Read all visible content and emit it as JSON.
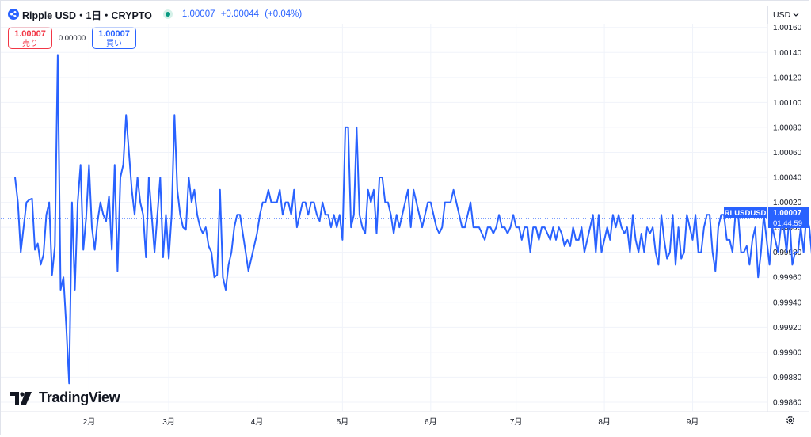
{
  "header": {
    "symbol_title": "Ripple USD・1日・CRYPTO",
    "price": "1.00007",
    "change": "+0.00044",
    "change_pct": "(+0.04%)"
  },
  "trade": {
    "sell_price": "1.00007",
    "sell_label": "売り",
    "spread": "0.00000",
    "buy_price": "1.00007",
    "buy_label": "買い"
  },
  "currency_selector": "USD",
  "brand": "TradingView",
  "last_price_label": {
    "symbol": "RLUSDUSD",
    "price": "1.00007",
    "countdown": "01:44:59"
  },
  "colors": {
    "line": "#2962ff",
    "grid": "#f0f3fa",
    "axis_text": "#131722",
    "label_bg": "#2962ff"
  },
  "icons": [
    "ripple-logo-icon",
    "live-dot-icon",
    "chevron-down-icon",
    "tradingview-logo-icon",
    "gear-icon"
  ],
  "chart_data": {
    "type": "line",
    "title": "Ripple USD・1日・CRYPTO",
    "xlabel": "",
    "ylabel": "",
    "x_range": [
      "2025-01-01",
      "2025-09-27"
    ],
    "ylim": [
      0.99853,
      1.00163
    ],
    "y_ticks": [
      1.0016,
      1.0014,
      1.0012,
      1.001,
      1.0008,
      1.0006,
      1.0004,
      1.0002,
      1.0,
      0.9998,
      0.9996,
      0.9994,
      0.9992,
      0.999,
      0.9988,
      0.9986
    ],
    "y_tick_labels": [
      "1.00160",
      "1.00140",
      "1.00120",
      "1.00100",
      "1.00080",
      "1.00060",
      "1.00040",
      "1.00020",
      "1.00000",
      "0.99980",
      "0.99960",
      "0.99940",
      "0.99920",
      "0.99900",
      "0.99880",
      "0.99860"
    ],
    "x_ticks": [
      {
        "date": "2025-02-01",
        "label": "2月"
      },
      {
        "date": "2025-03-01",
        "label": "3月"
      },
      {
        "date": "2025-04-01",
        "label": "4月"
      },
      {
        "date": "2025-05-01",
        "label": "5月"
      },
      {
        "date": "2025-06-01",
        "label": "6月"
      },
      {
        "date": "2025-07-01",
        "label": "7月"
      },
      {
        "date": "2025-08-01",
        "label": "8月"
      },
      {
        "date": "2025-09-01",
        "label": "9月"
      }
    ],
    "grid": true,
    "series": [
      {
        "x_start": "2025-01-06",
        "interval_days": 1,
        "values": [
          1.0004,
          1.0002,
          0.9998,
          1.0,
          1.0002,
          1.00022,
          1.00023,
          0.99982,
          0.99987,
          0.9997,
          0.99978,
          1.0001,
          1.0002,
          0.99962,
          0.99985,
          1.00138,
          0.9995,
          0.9996,
          0.9992,
          0.99875,
          1.0002,
          0.9995,
          1.0002,
          1.0005,
          0.99982,
          1.00008,
          1.0005,
          1.0,
          0.99982,
          1.00005,
          1.0002,
          1.0001,
          1.00005,
          1.00025,
          0.99982,
          1.0005,
          0.99965,
          1.0004,
          1.0005,
          1.0009,
          1.0006,
          1.0003,
          1.0001,
          1.0004,
          1.0002,
          1.0001,
          0.99976,
          1.0004,
          1.0001,
          0.9998,
          1.0001,
          1.0004,
          0.99976,
          1.0001,
          0.99975,
          1.0001,
          1.0009,
          1.0003,
          1.0001,
          1.0,
          0.99998,
          1.0004,
          1.0002,
          1.0003,
          1.0001,
          1.0,
          0.99995,
          1.0,
          0.99985,
          0.9998,
          0.9996,
          0.99962,
          1.0003,
          0.9996,
          0.9995,
          0.9997,
          0.9998,
          1.0,
          1.0001,
          1.0001,
          0.99995,
          0.9998,
          0.99965,
          0.99975,
          0.99985,
          0.99995,
          1.0001,
          1.0002,
          1.0002,
          1.0003,
          1.0002,
          1.0002,
          1.0002,
          1.0003,
          1.0001,
          1.0002,
          1.0002,
          1.0001,
          1.0003,
          1.0,
          1.0001,
          1.0002,
          1.0002,
          1.0001,
          1.0002,
          1.0002,
          1.0001,
          1.00005,
          1.0002,
          1.0001,
          1.0001,
          1.0,
          1.0001,
          1.0,
          1.0001,
          0.9999,
          1.0008,
          1.0008,
          1.0,
          1.0001,
          1.0008,
          1.0001,
          1.0,
          0.99995,
          1.0003,
          1.0002,
          1.0003,
          0.99995,
          1.0004,
          1.0004,
          1.0002,
          1.0002,
          1.0001,
          0.99995,
          1.0001,
          1.0,
          1.0001,
          1.0002,
          1.0003,
          1.0,
          1.0003,
          1.0002,
          1.0001,
          1.0,
          1.0001,
          1.0002,
          1.0002,
          1.0001,
          1.0,
          0.99995,
          1.0,
          1.0002,
          1.0002,
          1.0002,
          1.0003,
          1.0002,
          1.0001,
          1.0,
          1.0,
          1.0001,
          1.0002,
          1.0,
          1.0,
          1.0,
          0.99995,
          0.9999,
          1.0,
          1.0,
          0.99995,
          1.0,
          1.0001,
          1.0,
          1.0,
          0.99995,
          1.0,
          1.0001,
          1.0,
          1.0,
          0.9999,
          1.0,
          1.0,
          0.9998,
          1.0,
          1.0,
          0.9999,
          1.0,
          1.0,
          0.99995,
          0.9999,
          1.0,
          0.9999,
          1.0,
          0.99995,
          0.99985,
          0.9999,
          0.99985,
          1.0,
          0.9999,
          0.9999,
          1.0,
          0.9998,
          0.9999,
          1.0,
          1.0001,
          0.9998,
          1.0001,
          0.9998,
          0.9999,
          1.0,
          0.9999,
          1.0001,
          1.0,
          1.0001,
          1.0,
          0.99995,
          1.0,
          0.9998,
          1.0001,
          0.9999,
          0.9998,
          0.99995,
          0.9998,
          1.0,
          0.99995,
          1.0,
          0.9998,
          0.9997,
          1.0001,
          0.9999,
          0.99975,
          0.9998,
          1.0001,
          0.9997,
          1.0,
          0.99975,
          0.9998,
          1.0001,
          1.0,
          0.9999,
          1.0001,
          0.9998,
          0.9998,
          1.0,
          1.0001,
          1.0001,
          0.9998,
          0.99965,
          1.0,
          1.0001,
          1.0001,
          0.9999,
          0.9999,
          0.9998,
          1.0001,
          1.0001,
          0.9998,
          0.9998,
          0.99985,
          0.9997,
          0.9999,
          1.0,
          0.9996,
          0.9998,
          1.0001,
          0.9999,
          0.9997,
          1.0,
          0.9999,
          0.9998,
          1.0,
          1.0,
          0.9998,
          1.0001,
          0.9997,
          0.9998,
          0.9998,
          1.0,
          0.9998,
          1.0001,
          1.0,
          0.99975,
          0.9997,
          0.99985,
          0.9999,
          1.0,
          0.9998,
          1.0,
          0.9998,
          0.9999,
          0.99965,
          0.99995,
          0.9998,
          0.99985,
          0.9996,
          0.99955,
          0.99945,
          0.9998,
          0.99985,
          0.9999,
          0.9999,
          1.0001,
          0.99995,
          0.99965,
          1.00007
        ]
      }
    ]
  }
}
